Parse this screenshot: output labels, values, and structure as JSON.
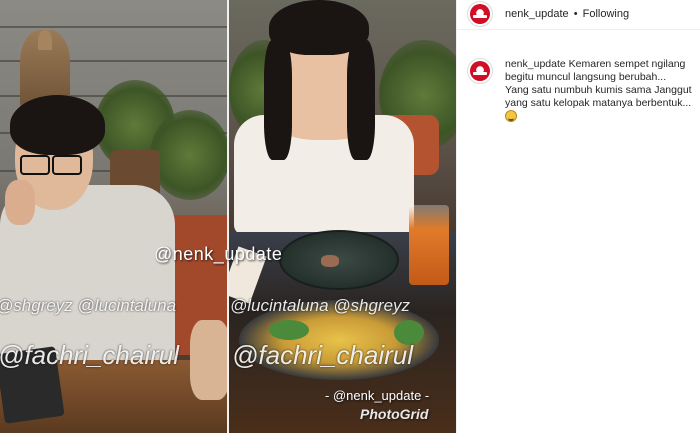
{
  "post": {
    "header": {
      "username": "nenk_update",
      "separator": "•",
      "follow_status": "Following"
    },
    "caption": {
      "username": "nenk_update",
      "line1": "Kemaren sempet ngilang begitu muncul langsung berubah...",
      "line2": "Yang satu numbuh kumis sama Janggut yang satu kelopak matanya berbentuk...",
      "emoji_icon": "grinning-face-icon"
    }
  },
  "media": {
    "watermark_main": "@nenk_update",
    "watermark_bottom": "- @nenk_update -",
    "watermark_app": "PhotoGrid",
    "overlay_tags_row1_left": "@shgreyz @lucintaluna",
    "overlay_tags_row1_right": "@lucintaluna @shgreyz",
    "overlay_tags_row2_left": "@fachri_chairul",
    "overlay_tags_row2_right": "@fachri_chairul"
  },
  "colors": {
    "avatar_red": "#d8102a",
    "text": "#262626",
    "divider": "#efefef"
  }
}
